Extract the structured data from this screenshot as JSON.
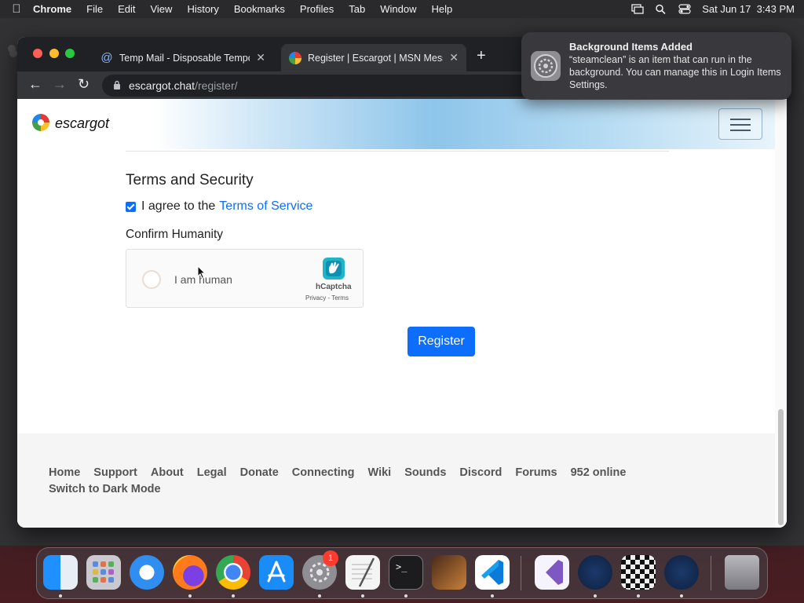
{
  "menubar": {
    "app_name": "Chrome",
    "items": [
      "File",
      "Edit",
      "View",
      "History",
      "Bookmarks",
      "Profiles",
      "Tab",
      "Window",
      "Help"
    ],
    "datetime": "Sat Jun 17  3:43 PM"
  },
  "browser": {
    "tabs": [
      {
        "title": "Temp Mail - Disposable Tempor",
        "favicon": "at-sign-icon"
      },
      {
        "title": "Register | Escargot | MSN Mess",
        "favicon": "escargot-icon"
      }
    ],
    "url_host": "escargot.chat",
    "url_path": "/register/"
  },
  "site": {
    "logo_text": "escargot"
  },
  "form": {
    "section_title": "Terms and Security",
    "agree_text": "I agree to the",
    "terms_link": "Terms of Service",
    "agree_checked": true,
    "confirm_label": "Confirm Humanity",
    "captcha_label": "I am human",
    "captcha_brand": "hCaptcha",
    "captcha_links": "Privacy - Terms",
    "register_label": "Register"
  },
  "footer": {
    "links": [
      "Home",
      "Support",
      "About",
      "Legal",
      "Donate",
      "Connecting",
      "Wiki",
      "Sounds",
      "Discord",
      "Forums",
      "952 online"
    ],
    "dark_mode": "Switch to Dark Mode"
  },
  "notification": {
    "title": "Background Items Added",
    "body": "“steamclean” is an item that can run in the background. You can manage this in Login Items Settings."
  },
  "dock": {
    "apps": [
      "finder-icon",
      "launchpad-icon",
      "safari-icon",
      "firefox-icon",
      "chrome-icon",
      "app-store-icon",
      "system-settings-icon",
      "textedit-icon",
      "terminal-icon",
      "garageband-icon",
      "vscode-icon",
      "visual-studio-icon",
      "steam-icon",
      "chess-icon",
      "steam-icon",
      "trash-icon"
    ],
    "settings_badge": "1"
  },
  "colors": {
    "accent": "#0d6efd",
    "footer_text": "#555555"
  }
}
